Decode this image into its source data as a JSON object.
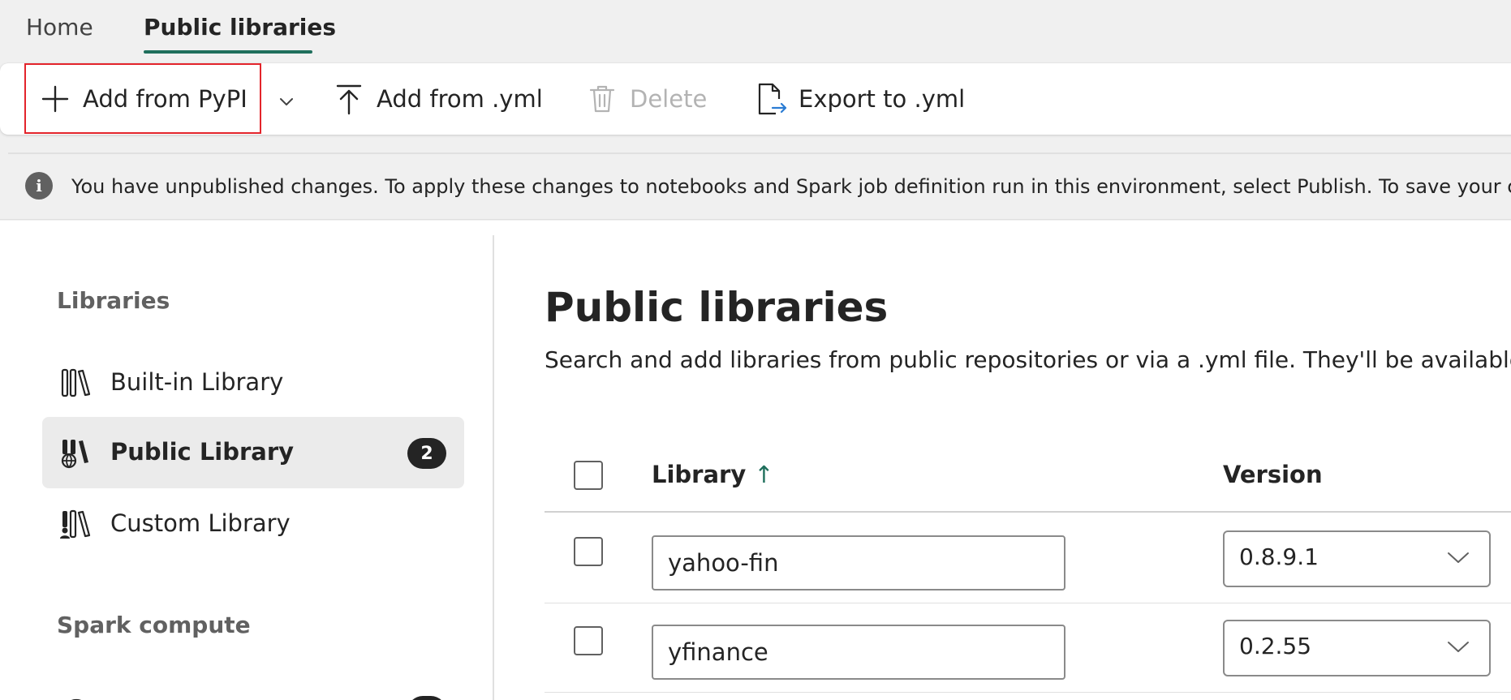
{
  "tabs": [
    {
      "label": "Home"
    },
    {
      "label": "Public libraries"
    }
  ],
  "toolbar": {
    "add_pypi": "Add from PyPI",
    "add_yml": "Add from .yml",
    "delete": "Delete",
    "export_yml": "Export to .yml"
  },
  "banner": {
    "text": "You have unpublished changes. To apply these changes to notebooks and Spark job definition run in this environment, select Publish. To save your chang"
  },
  "nav": {
    "libraries_heading": "Libraries",
    "items": [
      {
        "label": "Built-in Library",
        "icon": "books-icon"
      },
      {
        "label": "Public Library",
        "icon": "globe-books-icon",
        "badge": "2"
      },
      {
        "label": "Custom Library",
        "icon": "person-books-icon"
      }
    ],
    "spark_heading": "Spark compute"
  },
  "main": {
    "title": "Public libraries",
    "description": "Search and add libraries from public repositories or via a .yml file. They'll be available if y",
    "columns": {
      "library": "Library",
      "sort_arrow": "↑",
      "version": "Version"
    },
    "rows": [
      {
        "library": "yahoo-fin",
        "version": "0.8.9.1"
      },
      {
        "library": "yfinance",
        "version": "0.2.55"
      }
    ]
  },
  "colors": {
    "accent": "#1f6f5c",
    "highlight_border": "#e3242b",
    "badge_bg": "#242424"
  }
}
